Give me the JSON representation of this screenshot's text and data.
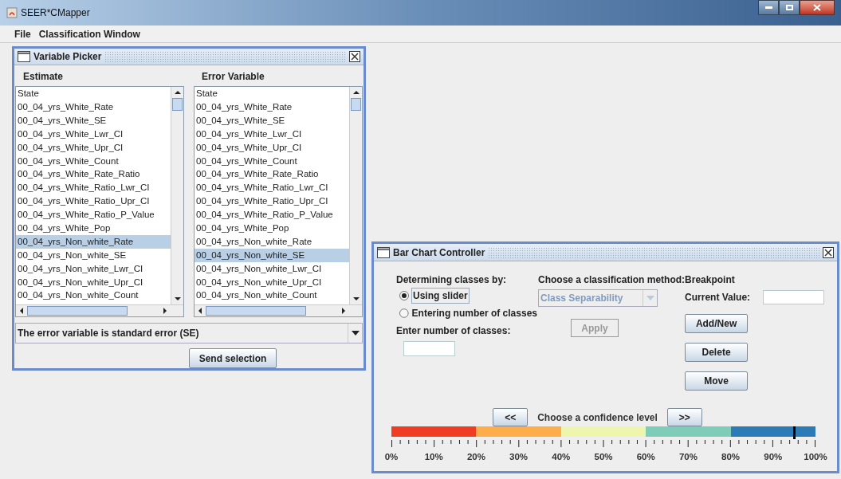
{
  "window": {
    "title": "SEER*CMapper"
  },
  "menu": [
    "File",
    "Classification Window"
  ],
  "variable_picker": {
    "title": "Variable Picker",
    "estimate": {
      "label": "Estimate",
      "items": [
        {
          "text": "State",
          "selected": false
        },
        {
          "text": "00_04_yrs_White_Rate",
          "selected": false
        },
        {
          "text": "00_04_yrs_White_SE",
          "selected": false
        },
        {
          "text": "00_04_yrs_White_Lwr_CI",
          "selected": false
        },
        {
          "text": "00_04_yrs_White_Upr_CI",
          "selected": false
        },
        {
          "text": "00_04_yrs_White_Count",
          "selected": false
        },
        {
          "text": "00_04_yrs_White_Rate_Ratio",
          "selected": false
        },
        {
          "text": "00_04_yrs_White_Ratio_Lwr_CI",
          "selected": false
        },
        {
          "text": "00_04_yrs_White_Ratio_Upr_CI",
          "selected": false
        },
        {
          "text": "00_04_yrs_White_Ratio_P_Value",
          "selected": false
        },
        {
          "text": "00_04_yrs_White_Pop",
          "selected": false
        },
        {
          "text": "00_04_yrs_Non_white_Rate",
          "selected": true
        },
        {
          "text": "00_04_yrs_Non_white_SE",
          "selected": false
        },
        {
          "text": "00_04_yrs_Non_white_Lwr_CI",
          "selected": false
        },
        {
          "text": "00_04_yrs_Non_white_Upr_CI",
          "selected": false
        },
        {
          "text": "00_04_yrs_Non_white_Count",
          "selected": false
        }
      ]
    },
    "error": {
      "label": "Error Variable",
      "items": [
        {
          "text": "State",
          "selected": false
        },
        {
          "text": "00_04_yrs_White_Rate",
          "selected": false
        },
        {
          "text": "00_04_yrs_White_SE",
          "selected": false
        },
        {
          "text": "00_04_yrs_White_Lwr_CI",
          "selected": false
        },
        {
          "text": "00_04_yrs_White_Upr_CI",
          "selected": false
        },
        {
          "text": "00_04_yrs_White_Count",
          "selected": false
        },
        {
          "text": "00_04_yrs_White_Rate_Ratio",
          "selected": false
        },
        {
          "text": "00_04_yrs_White_Ratio_Lwr_CI",
          "selected": false
        },
        {
          "text": "00_04_yrs_White_Ratio_Upr_CI",
          "selected": false
        },
        {
          "text": "00_04_yrs_White_Ratio_P_Value",
          "selected": false
        },
        {
          "text": "00_04_yrs_White_Pop",
          "selected": false
        },
        {
          "text": "00_04_yrs_Non_white_Rate",
          "selected": false
        },
        {
          "text": "00_04_yrs_Non_white_SE",
          "selected": true
        },
        {
          "text": "00_04_yrs_Non_white_Lwr_CI",
          "selected": false
        },
        {
          "text": "00_04_yrs_Non_white_Upr_CI",
          "selected": false
        },
        {
          "text": "00_04_yrs_Non_white_Count",
          "selected": false
        }
      ]
    },
    "error_type": "The error variable is standard error (SE)",
    "send_button": "Send selection"
  },
  "bar_chart_controller": {
    "title": "Bar Chart Controller",
    "determining_label": "Determining classes by:",
    "radios": [
      {
        "label": "Using slider",
        "selected": true
      },
      {
        "label": "Entering number of classes",
        "selected": false
      }
    ],
    "number_label": "Enter number of classes:",
    "method_label": "Choose a classification method:",
    "method": {
      "value": "Class Separability",
      "disabled": true
    },
    "apply": {
      "label": "Apply",
      "disabled": true
    },
    "breakpoint_label": "Breakpoint",
    "current_value_label": "Current Value:",
    "buttons": [
      "Add/New",
      "Delete",
      "Move"
    ],
    "prev": "<<",
    "next": ">>",
    "confidence_label": "Choose a confidence level",
    "slider": {
      "level": 0.95,
      "segments": [
        {
          "color": "#f03c22"
        },
        {
          "color": "#fdae4b"
        },
        {
          "color": "#eef6ad"
        },
        {
          "color": "#7fccb9"
        },
        {
          "color": "#2b7bb6"
        }
      ],
      "ticks": [
        "0%",
        "10%",
        "20%",
        "30%",
        "40%",
        "50%",
        "60%",
        "70%",
        "80%",
        "90%",
        "100%"
      ]
    }
  }
}
